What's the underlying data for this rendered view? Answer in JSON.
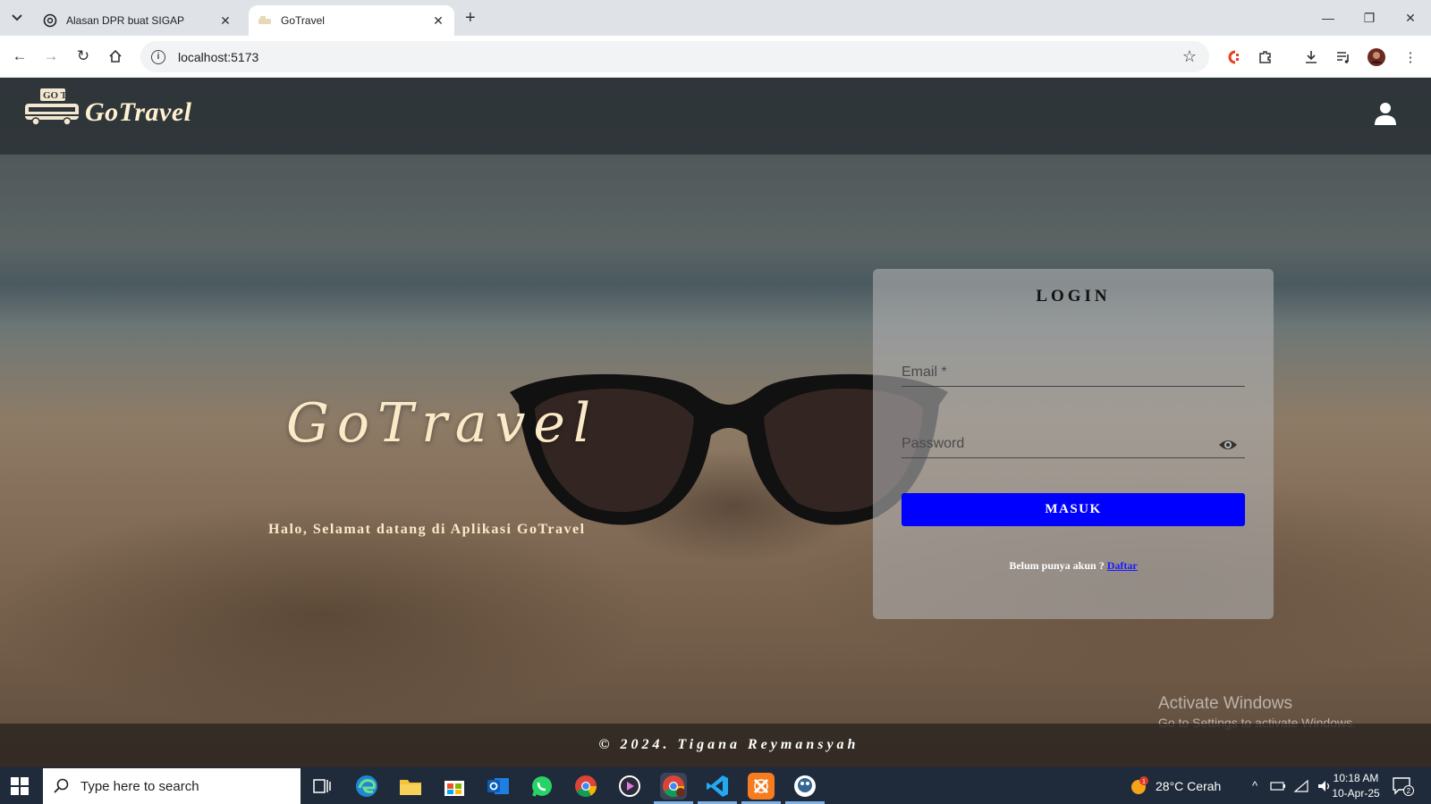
{
  "browser": {
    "tabs": [
      {
        "title": "Alasan DPR buat SIGAP",
        "active": false
      },
      {
        "title": "GoTravel",
        "active": true
      }
    ],
    "url": "localhost:5173"
  },
  "header": {
    "logo_text": "GoTravel",
    "logo_badge": "GO Travel"
  },
  "hero": {
    "title": "GoTravel",
    "subtitle": "Halo, Selamat datang di Aplikasi GoTravel"
  },
  "login": {
    "title": "LOGIN",
    "email_label": "Email *",
    "password_label": "Password",
    "submit_label": "MASUK",
    "register_prompt": "Belum punya akun ?",
    "register_link": "Daftar",
    "submit_color": "#0000ff"
  },
  "footer": {
    "copyright": "© 2024. Tigana Reymansyah"
  },
  "watermark": {
    "line1": "Activate Windows",
    "line2": "Go to Settings to activate Windows."
  },
  "taskbar": {
    "search_placeholder": "Type here to search",
    "weather": "28°C  Cerah",
    "time": "10:18 AM",
    "date": "10-Apr-25",
    "notification_count": "2",
    "weather_badge": "1"
  }
}
